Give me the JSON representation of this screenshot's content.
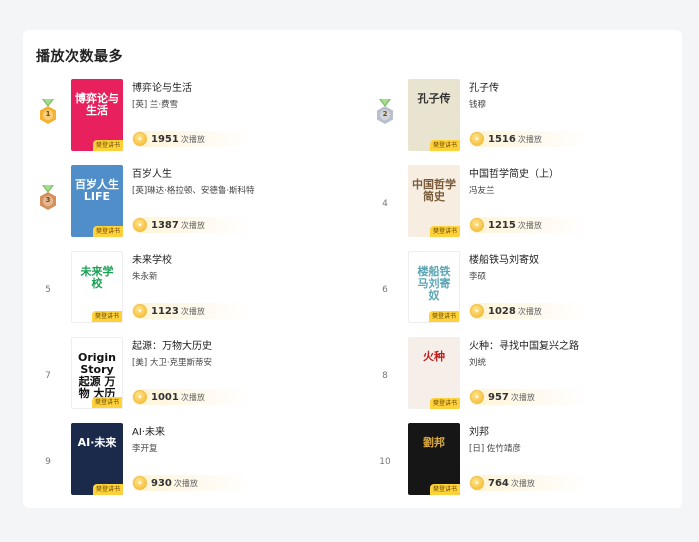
{
  "section_title": "播放次数最多",
  "play_suffix": "次播放",
  "cover_tag": "樊登讲书",
  "coin_glyph": "✦",
  "items": [
    {
      "rank": "1",
      "title": "博弈论与生活",
      "author": "[英] 兰·费雪",
      "plays": "1951",
      "cover_text": "博弈论与生活",
      "cover_bg": "#e8215e",
      "cover_fg": "#ffffff"
    },
    {
      "rank": "2",
      "title": "孔子传",
      "author": "钱穆",
      "plays": "1516",
      "cover_text": "孔子传",
      "cover_bg": "#e9e4cf",
      "cover_fg": "#333333"
    },
    {
      "rank": "3",
      "title": "百岁人生",
      "author": "[英]琳达·格拉顿、安德鲁·斯科特",
      "plays": "1387",
      "cover_text": "百岁人生 LIFE",
      "cover_bg": "#4f8ec9",
      "cover_fg": "#ffffff"
    },
    {
      "rank": "4",
      "title": "中国哲学简史（上）",
      "author": "冯友兰",
      "plays": "1215",
      "cover_text": "中国哲学简史",
      "cover_bg": "#f7eee1",
      "cover_fg": "#7a5a3a"
    },
    {
      "rank": "5",
      "title": "未来学校",
      "author": "朱永新",
      "plays": "1123",
      "cover_text": "未来学校",
      "cover_bg": "#ffffff",
      "cover_fg": "#1aa155"
    },
    {
      "rank": "6",
      "title": "楼船铁马刘寄奴",
      "author": "李硕",
      "plays": "1028",
      "cover_text": "楼船铁马刘寄奴",
      "cover_bg": "#ffffff",
      "cover_fg": "#5aa6b5"
    },
    {
      "rank": "7",
      "title": "起源：万物大历史",
      "author": "[美] 大卫·克里斯蒂安",
      "plays": "1001",
      "cover_text": "Origin Story 起源 万物 大历史",
      "cover_bg": "#ffffff",
      "cover_fg": "#111111"
    },
    {
      "rank": "8",
      "title": "火种：寻找中国复兴之路",
      "author": "刘统",
      "plays": "957",
      "cover_text": "火种",
      "cover_bg": "#f6efe9",
      "cover_fg": "#c41a1a"
    },
    {
      "rank": "9",
      "title": "AI·未来",
      "author": "李开复",
      "plays": "930",
      "cover_text": "AI·未来",
      "cover_bg": "#1b2a4a",
      "cover_fg": "#ffffff"
    },
    {
      "rank": "10",
      "title": "刘邦",
      "author": "[日] 佐竹靖彦",
      "plays": "764",
      "cover_text": "劉邦",
      "cover_bg": "#161616",
      "cover_fg": "#d9a941"
    }
  ],
  "colors": {
    "gold": "#f3b233",
    "silver": "#b9c0cc",
    "bronze": "#d48f5b",
    "tag_bg": "#ffd23c",
    "coin": "#f5b52a"
  }
}
